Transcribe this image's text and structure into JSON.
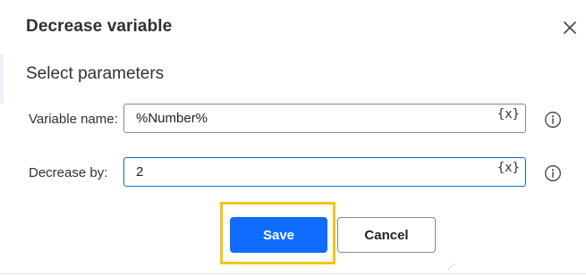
{
  "dialog": {
    "title": "Decrease variable",
    "section_title": "Select parameters"
  },
  "fields": {
    "variable_name": {
      "label": "Variable name:",
      "value": "%Number%",
      "var_button": "{x}"
    },
    "decrease_by": {
      "label": "Decrease by:",
      "value": "2",
      "var_button": "{x}"
    }
  },
  "buttons": {
    "save_label": "Save",
    "cancel_label": "Cancel"
  },
  "icons": {
    "close": "close-icon",
    "info": "info-icon",
    "variable": "variable-icon"
  },
  "colors": {
    "primary": "#0f6cff",
    "highlight": "#f5c518",
    "focus_border": "#0f6cbd"
  }
}
